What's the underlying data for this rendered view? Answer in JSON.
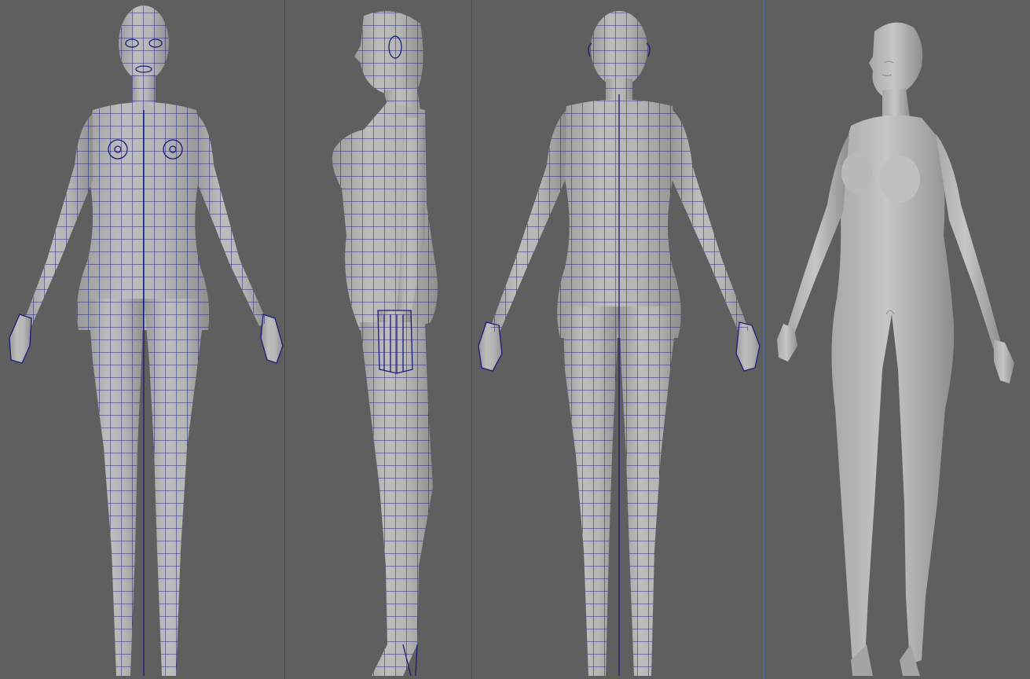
{
  "viewports": [
    {
      "name": "front",
      "mode": "wireframe-on-shaded"
    },
    {
      "name": "side",
      "mode": "wireframe-on-shaded"
    },
    {
      "name": "back",
      "mode": "wireframe-on-shaded"
    },
    {
      "name": "perspective",
      "mode": "smooth-shaded",
      "active_border": true
    }
  ],
  "colors": {
    "background": "#5f5f5f",
    "wire": "#1c1c7a",
    "surface": "#b4b4b4",
    "surface_shade": "#9c9c9c",
    "active_border": "#4d6a9a"
  }
}
